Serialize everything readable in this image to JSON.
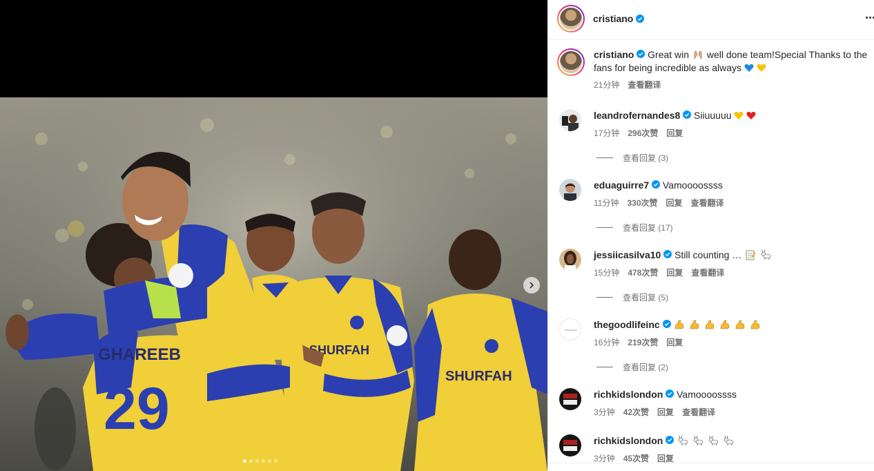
{
  "post": {
    "username": "cristiano",
    "more_icon": "more-horizontal-icon"
  },
  "caption": {
    "username": "cristiano",
    "text": "Great win",
    "text2": "well done team!Special Thanks to the fans for being incredible as always",
    "time": "21分钟",
    "translate": "查看翻译"
  },
  "comments": [
    {
      "username": "leandrofernandes8",
      "text": "Siiuuuuu",
      "time": "17分钟",
      "likes": "296次赞",
      "reply": "回复",
      "translate": "",
      "view_replies": "查看回复 (3)"
    },
    {
      "username": "eduaguirre7",
      "text": "Vamoooossss",
      "time": "11分钟",
      "likes": "330次赞",
      "reply": "回复",
      "translate": "查看翻译",
      "view_replies": "查看回复 (17)"
    },
    {
      "username": "jessiicasilva10",
      "text": "Still counting …",
      "time": "15分钟",
      "likes": "478次赞",
      "reply": "回复",
      "translate": "查看翻译",
      "view_replies": "查看回复 (5)"
    },
    {
      "username": "thegoodlifeinc",
      "text": "",
      "time": "16分钟",
      "likes": "219次赞",
      "reply": "回复",
      "translate": "",
      "view_replies": "查看回复 (2)"
    },
    {
      "username": "richkidslondon",
      "text": "Vamoooossss",
      "time": "3分钟",
      "likes": "42次赞",
      "reply": "回复",
      "translate": "查看翻译",
      "view_replies": ""
    },
    {
      "username": "richkidslondon",
      "text": "",
      "time": "3分钟",
      "likes": "45次赞",
      "reply": "回复",
      "translate": "",
      "view_replies": ""
    }
  ],
  "photo": {
    "jersey_text": "SHURFAH",
    "player_name": "GHAREEB",
    "player_number": "29"
  },
  "colors": {
    "verified": "#0095f6",
    "jersey_yellow": "#f2d13a",
    "jersey_blue": "#2b3fb0",
    "muted": "#737373"
  }
}
